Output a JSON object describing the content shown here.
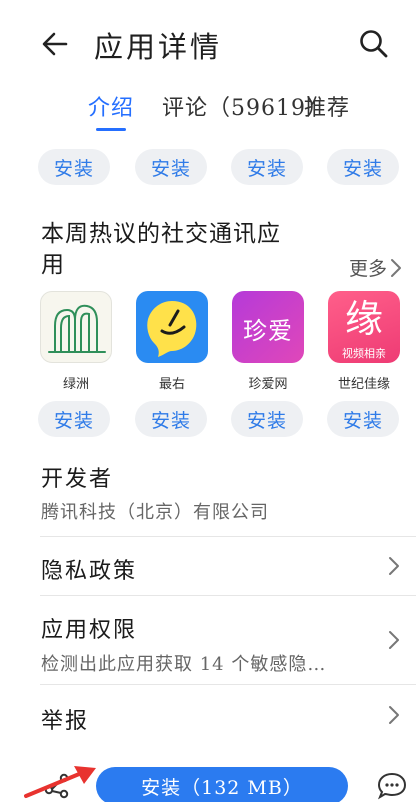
{
  "header": {
    "back_icon": "back-arrow-icon",
    "title": "应用详情",
    "search_icon": "search-icon"
  },
  "tabs": [
    {
      "label": "介绍",
      "active": true
    },
    {
      "label": "评论（59619）",
      "active": false
    },
    {
      "label": "推荐",
      "active": false
    }
  ],
  "top_row": {
    "install_labels": [
      "安装",
      "安装",
      "安装",
      "安装"
    ]
  },
  "social_section": {
    "title": "本周热议的社交通讯应用",
    "more_label": "更多",
    "apps": [
      {
        "name": "绿洲",
        "icon": "lvzhou-app-icon",
        "install_label": "安装"
      },
      {
        "name": "最右",
        "icon": "zuiyou-app-icon",
        "install_label": "安装"
      },
      {
        "name": "珍爱网",
        "icon": "zhenai-app-icon",
        "icon_text": "珍爱",
        "install_label": "安装"
      },
      {
        "name": "世纪佳缘",
        "icon": "jiayuan-app-icon",
        "icon_text": "缘",
        "icon_subtext": "视频相亲",
        "install_label": "安装"
      }
    ]
  },
  "developer": {
    "title": "开发者",
    "value": "腾讯科技（北京）有限公司"
  },
  "privacy": {
    "title": "隐私政策"
  },
  "permissions": {
    "title": "应用权限",
    "summary": "检测出此应用获取 14 个敏感隐…"
  },
  "report": {
    "title": "举报"
  },
  "bottom_bar": {
    "share_icon": "share-icon",
    "install_label": "安装（132 MB）",
    "comment_icon": "comment-icon"
  },
  "colors": {
    "accent": "#256fff",
    "install_button": "#2b7bf0",
    "pill_background": "#eef0f3",
    "annotation_arrow": "#e8332f"
  }
}
